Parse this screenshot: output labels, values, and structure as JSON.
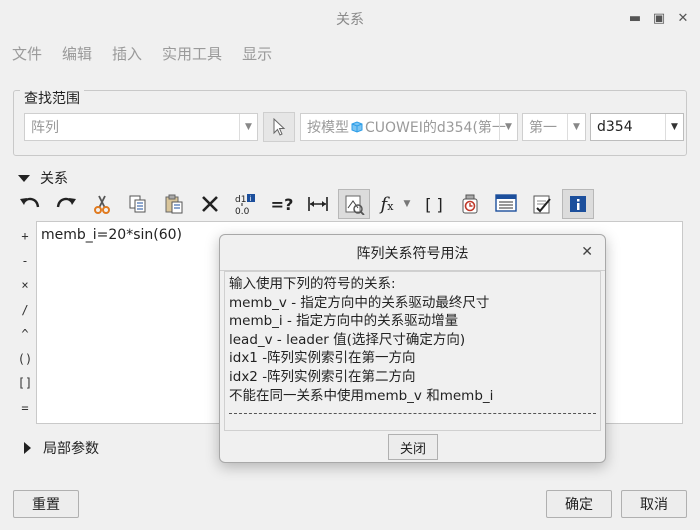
{
  "window": {
    "title": "关系"
  },
  "menu": [
    "文件",
    "编辑",
    "插入",
    "实用工具",
    "显示"
  ],
  "search": {
    "legend": "查找范围",
    "type_value": "阵列",
    "model_value": "按模型",
    "model_name": "CUOWEI的d354(第一",
    "direction_value": "第一",
    "dim_value": "d354"
  },
  "relations": {
    "label": "关系",
    "operators": [
      "+",
      "-",
      "×",
      "/",
      "^",
      "()",
      "[]",
      "="
    ],
    "text": "memb_i=20*sin(60)"
  },
  "toolbar_icons": [
    "undo-icon",
    "redo-icon",
    "cut-icon",
    "copy-icon",
    "paste-icon",
    "delete-icon",
    "switch-dims-icon",
    "evaluate-icon",
    "dimension-icon",
    "show-dims-icon",
    "function-icon",
    "parameters-icon",
    "verify-icon",
    "sort-icon",
    "check-icon",
    "info-icon"
  ],
  "toolbar_text": {
    "switch_dims": "d1",
    "switch_value": "0.0",
    "evaluate": "=?",
    "function": "f",
    "function_sub": "x",
    "parameters": "[ ]"
  },
  "local_params": {
    "label": "局部参数"
  },
  "footer": {
    "reset": "重置",
    "ok": "确定",
    "cancel": "取消"
  },
  "dialog": {
    "title": "阵列关系符号用法",
    "lines": [
      " 输入使用下列的符号的关系:",
      "memb_v - 指定方向中的关系驱动最终尺寸",
      "memb_i - 指定方向中的关系驱动增量",
      "lead_v - leader 值(选择尺寸确定方向)",
      "idx1    -阵列实例索引在第一方向",
      "idx2    -阵列实例索引在第二方向",
      "  不能在同一关系中使用memb_v 和memb_i"
    ],
    "close_label": "关闭"
  },
  "colors": {
    "accent_blue": "#1c4f9c",
    "cube_blue": "#2d9ee8",
    "cut_orange": "#e07a1f"
  }
}
